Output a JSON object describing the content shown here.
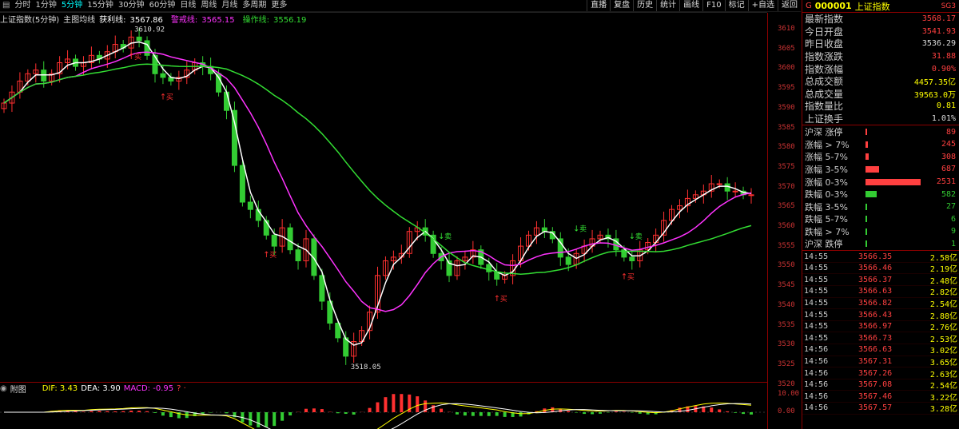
{
  "toolbar": {
    "periods": [
      {
        "label": "分时",
        "active": false
      },
      {
        "label": "1分钟",
        "active": false
      },
      {
        "label": "5分钟",
        "active": true
      },
      {
        "label": "15分钟",
        "active": false
      },
      {
        "label": "30分钟",
        "active": false
      },
      {
        "label": "60分钟",
        "active": false
      },
      {
        "label": "日线",
        "active": false
      },
      {
        "label": "周线",
        "active": false
      },
      {
        "label": "月线",
        "active": false
      },
      {
        "label": "多周期",
        "active": false
      },
      {
        "label": "更多",
        "active": false
      }
    ],
    "right": [
      "直播",
      "复盘",
      "历史",
      "统计",
      "画线",
      "F10",
      "标记",
      "+自选",
      "返回"
    ]
  },
  "indicator_bar": {
    "title": "上证指数(5分钟)",
    "ma_label": "主图均线",
    "profit_label": "获利线:",
    "profit_value": "3567.86",
    "warn_label": "警戒线:",
    "warn_value": "3565.15",
    "op_label": "操作线:",
    "op_value": "3556.19"
  },
  "sub_bar": {
    "label": "附图",
    "dif": "DIF: 3.43",
    "dea": "DEA: 3.90",
    "macd": "MACD: -0.95"
  },
  "main_chart": {
    "y_ticks": [
      "3610",
      "3605",
      "3600",
      "3595",
      "3590",
      "3585",
      "3580",
      "3575",
      "3570",
      "3565",
      "3560",
      "3555",
      "3550",
      "3545",
      "3540",
      "3535",
      "3530",
      "3525",
      "3520"
    ],
    "high_label": "3610.92",
    "low_label": "3518.05",
    "signals": [
      {
        "text": "买",
        "kind": "buy"
      },
      {
        "text": "买",
        "kind": "buy"
      },
      {
        "text": "卖",
        "kind": "sell"
      },
      {
        "text": "卖",
        "kind": "sell"
      },
      {
        "text": "卖",
        "kind": "sell"
      },
      {
        "text": "买",
        "kind": "buy"
      },
      {
        "text": "买",
        "kind": "buy"
      },
      {
        "text": "买",
        "kind": "buy"
      }
    ],
    "colors": {
      "up": "#ff3030",
      "down": "#33cc33",
      "white": "#ffffff",
      "magenta": "#ff33ff",
      "green": "#33dd33",
      "axis": "#8b0000"
    }
  },
  "sub_chart": {
    "y_ticks": [
      "10.00",
      "0.00"
    ]
  },
  "chart_data": {
    "type": "candlestick",
    "ylim": [
      3516,
      3614
    ],
    "closes": [
      3592,
      3595,
      3598,
      3600,
      3601,
      3598,
      3600,
      3603,
      3604,
      3602,
      3603,
      3605,
      3604,
      3606,
      3608,
      3607,
      3610,
      3609,
      3605,
      3600,
      3599,
      3598,
      3599,
      3601,
      3603,
      3602,
      3600,
      3595,
      3590,
      3575,
      3565,
      3563,
      3560,
      3556,
      3553,
      3558,
      3552,
      3549,
      3555,
      3545,
      3538,
      3532,
      3528,
      3523,
      3527,
      3530,
      3535,
      3545,
      3549,
      3550,
      3551,
      3557,
      3558,
      3556,
      3551,
      3549,
      3545,
      3549,
      3550,
      3552,
      3548,
      3546,
      3544,
      3545,
      3549,
      3553,
      3556,
      3558,
      3557,
      3555,
      3550,
      3548,
      3551,
      3553,
      3555,
      3556,
      3555,
      3552,
      3550,
      3549,
      3552,
      3554,
      3556,
      3560,
      3563,
      3564,
      3566,
      3567,
      3568,
      3570,
      3570,
      3568,
      3568,
      3567,
      3567
    ]
  },
  "quote_panel": {
    "badge": "G",
    "code": "000001",
    "name": "上证指数",
    "tag": "SG3",
    "rows": [
      {
        "k": "最新指数",
        "v": "3568.17",
        "c": "#ff4040"
      },
      {
        "k": "今日开盘",
        "v": "3541.93",
        "c": "#ff4040"
      },
      {
        "k": "昨日收盘",
        "v": "3536.29",
        "c": "#dddddd"
      },
      {
        "k": "指数涨跌",
        "v": "31.88",
        "c": "#ff4040"
      },
      {
        "k": "指数涨幅",
        "v": "0.90%",
        "c": "#ff4040"
      },
      {
        "k": "总成交额",
        "v": "4457.35亿",
        "c": "#ffff00"
      },
      {
        "k": "总成交量",
        "v": "39563.0万",
        "c": "#ffff00"
      },
      {
        "k": "指数量比",
        "v": "0.81",
        "c": "#ffff00"
      },
      {
        "k": "上证换手",
        "v": "1.01%",
        "c": "#dddddd"
      }
    ],
    "breadth": [
      {
        "k": "沪深 涨停",
        "v": "89",
        "c": "#ff4040",
        "frac": 0.01
      },
      {
        "k": "涨幅 > 7%",
        "v": "245",
        "c": "#ff4040",
        "frac": 0.03
      },
      {
        "k": "涨幅 5-7%",
        "v": "308",
        "c": "#ff4040",
        "frac": 0.04
      },
      {
        "k": "涨幅 3-5%",
        "v": "687",
        "c": "#ff4040",
        "frac": 0.18
      },
      {
        "k": "涨幅 0-3%",
        "v": "2531",
        "c": "#ff4040",
        "frac": 0.72
      },
      {
        "k": "跌幅 0-3%",
        "v": "582",
        "c": "#33cc33",
        "frac": 0.15
      },
      {
        "k": "跌幅 3-5%",
        "v": "27",
        "c": "#33cc33",
        "frac": 0.01
      },
      {
        "k": "跌幅 5-7%",
        "v": "6",
        "c": "#33cc33",
        "frac": 0.005
      },
      {
        "k": "跌幅 > 7%",
        "v": "9",
        "c": "#33cc33",
        "frac": 0.005
      },
      {
        "k": "沪深 跌停",
        "v": "1",
        "c": "#33cc33",
        "frac": 0.003
      }
    ],
    "ticks": [
      {
        "t": "14:55",
        "p": "3566.35",
        "vol": "2.58亿"
      },
      {
        "t": "14:55",
        "p": "3566.46",
        "vol": "2.19亿"
      },
      {
        "t": "14:55",
        "p": "3566.37",
        "vol": "2.48亿"
      },
      {
        "t": "14:55",
        "p": "3566.63",
        "vol": "2.82亿"
      },
      {
        "t": "14:55",
        "p": "3566.82",
        "vol": "2.54亿"
      },
      {
        "t": "14:55",
        "p": "3566.43",
        "vol": "2.88亿"
      },
      {
        "t": "14:55",
        "p": "3566.97",
        "vol": "2.76亿"
      },
      {
        "t": "14:55",
        "p": "3566.73",
        "vol": "2.53亿"
      },
      {
        "t": "14:56",
        "p": "3566.63",
        "vol": "3.02亿"
      },
      {
        "t": "14:56",
        "p": "3567.31",
        "vol": "3.65亿"
      },
      {
        "t": "14:56",
        "p": "3567.26",
        "vol": "2.63亿"
      },
      {
        "t": "14:56",
        "p": "3567.08",
        "vol": "2.54亿"
      },
      {
        "t": "14:56",
        "p": "3567.46",
        "vol": "3.22亿"
      },
      {
        "t": "14:56",
        "p": "3567.57",
        "vol": "3.28亿"
      }
    ]
  }
}
